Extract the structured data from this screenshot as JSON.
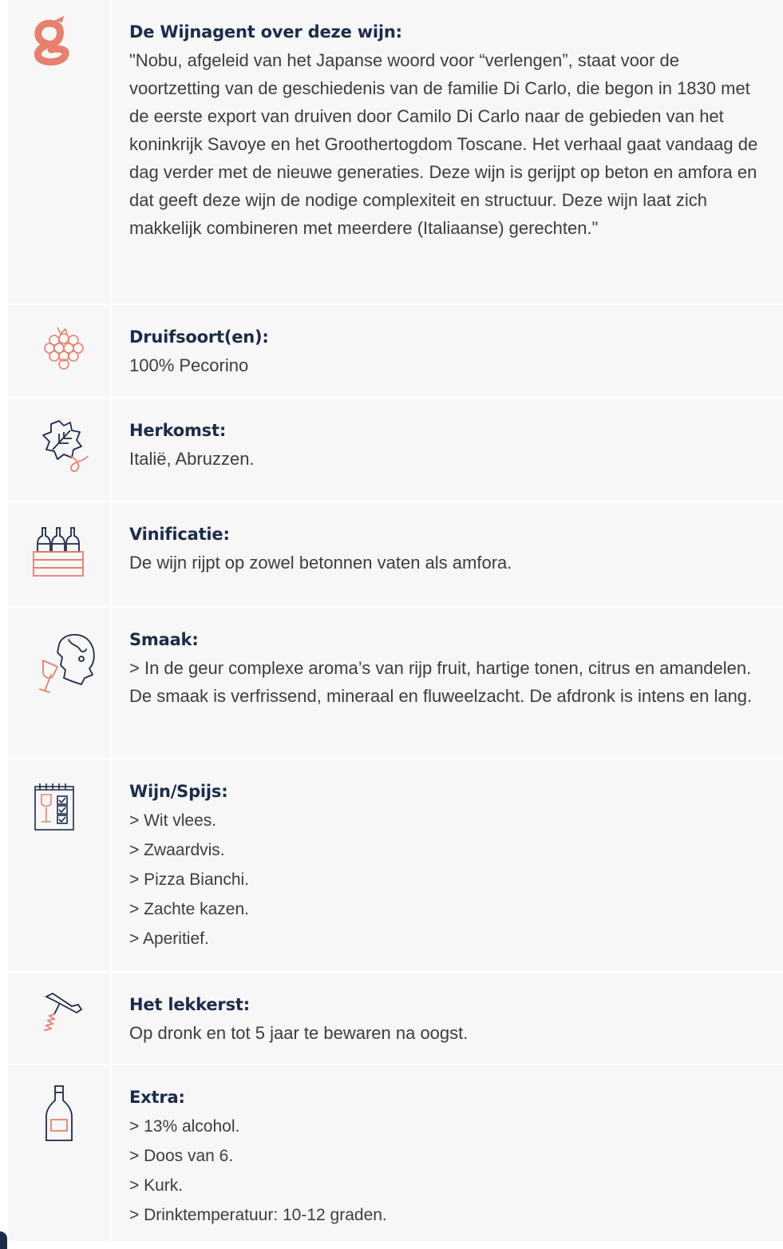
{
  "sections": [
    {
      "icon": "wijnagent-logo-icon",
      "title": "De Wijnagent over deze wijn:",
      "body": "\"Nobu, afgeleid van het Japanse woord voor “verlengen”, staat voor de voortzetting van de geschiedenis van de familie Di Carlo, die begon in 1830 met de eerste export van druiven door Camilo Di Carlo naar de gebieden van het koninkrijk Savoye en het Groothertogdom Toscane. Het verhaal gaat vandaag de dag verder met de nieuwe generaties. Deze wijn is gerijpt op beton en amfora en dat geeft deze wijn de nodige complexiteit en structuur. Deze wijn laat zich makkelijk combineren met meerdere (Italiaanse) gerechten.\""
    },
    {
      "icon": "grapes-icon",
      "title": "Druifsoort(en):",
      "body": "100% Pecorino"
    },
    {
      "icon": "vine-leaf-icon",
      "title": "Herkomst:",
      "body": "Italië, Abruzzen."
    },
    {
      "icon": "wine-crate-icon",
      "title": "Vinificatie:",
      "body": "De wijn rijpt op zowel betonnen vaten als amfora."
    },
    {
      "icon": "tasting-face-icon",
      "title": "Smaak:",
      "body": "> In de geur complexe aroma’s van rijp fruit, hartige tonen, citrus en amandelen. De smaak is verfrissend, mineraal en fluweelzacht. De afdronk is intens en lang."
    },
    {
      "icon": "menu-checklist-icon",
      "title": "Wijn/Spijs:",
      "items": [
        "> Wit vlees.",
        "> Zwaardvis.",
        "> Pizza Bianchi.",
        "> Zachte kazen.",
        "> Aperitief."
      ]
    },
    {
      "icon": "corkscrew-icon",
      "title": "Het lekkerst:",
      "body": "Op dronk en tot 5 jaar te bewaren na oogst."
    },
    {
      "icon": "wine-bottle-icon",
      "title": "Extra:",
      "items": [
        "> 13% alcohol.",
        "> Doos van 6.",
        "> Kurk.",
        "> Drinktemperatuur: 10-12 graden."
      ]
    }
  ],
  "colors": {
    "accent": "#e8806e",
    "heading": "#1c2b4b",
    "text": "#3a3d44",
    "panel": "#f7f7f7"
  }
}
